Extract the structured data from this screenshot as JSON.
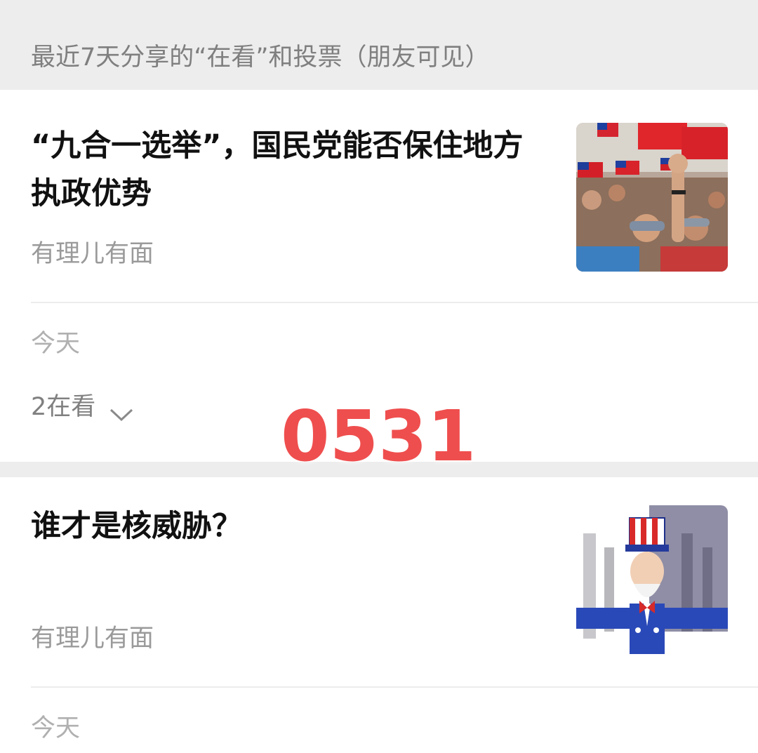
{
  "header": {
    "title": "最近7天分享的“在看”和投票（朋友可见）"
  },
  "articles": [
    {
      "title": "“九合一选举”，国民党能否保住地方执政优势",
      "source": "有理儿有面",
      "date": "今天",
      "viewing": "2在看",
      "thumbnail_icon": "rally-flags-photo"
    },
    {
      "title": "谁才是核威胁？",
      "source": "有理儿有面",
      "date": "今天",
      "thumbnail_icon": "uncle-sam-cartoon"
    }
  ],
  "overlay": {
    "number": "0531",
    "color": "#ee3b3b"
  },
  "colors": {
    "background": "#ededed",
    "card": "#ffffff",
    "title": "#111111",
    "secondary": "#9a9a9a"
  }
}
